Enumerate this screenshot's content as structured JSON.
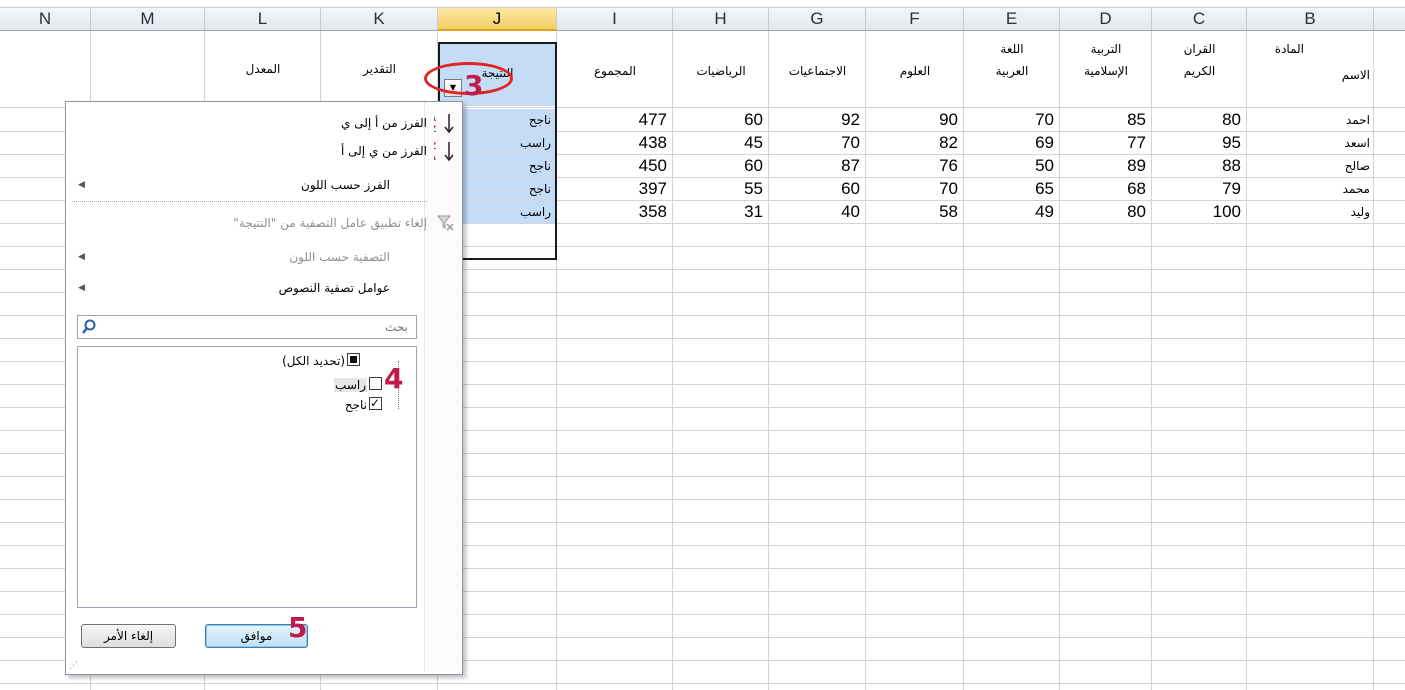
{
  "columns": [
    "N",
    "M",
    "L",
    "K",
    "J",
    "I",
    "H",
    "G",
    "F",
    "E",
    "D",
    "C",
    "B"
  ],
  "selected_column": "J",
  "headers": {
    "L": "المعدل",
    "K": "التقدير",
    "J": "النتيجة",
    "I": "المجموع",
    "H": "الرياضيات",
    "G": "الاجتماعيات",
    "F": "العلوم",
    "E1": "اللغة",
    "E2": "العربية",
    "D1": "التربية",
    "D2": "الإسلامية",
    "C1": "القران",
    "C2": "الكريم",
    "B1": "المادة",
    "B2": "الاسم"
  },
  "rows": [
    {
      "J": "ناجح",
      "I": "477",
      "H": "60",
      "G": "92",
      "F": "90",
      "E": "70",
      "D": "85",
      "C": "80",
      "B": "احمد"
    },
    {
      "J": "راسب",
      "I": "438",
      "H": "45",
      "G": "70",
      "F": "82",
      "E": "69",
      "D": "77",
      "C": "95",
      "B": "اسعد"
    },
    {
      "J": "ناجح",
      "I": "450",
      "H": "60",
      "G": "87",
      "F": "76",
      "E": "50",
      "D": "89",
      "C": "88",
      "B": "صالح"
    },
    {
      "J": "ناجح",
      "I": "397",
      "H": "55",
      "G": "60",
      "F": "70",
      "E": "65",
      "D": "68",
      "C": "79",
      "B": "محمد"
    },
    {
      "J": "راسب",
      "I": "358",
      "H": "31",
      "G": "40",
      "F": "58",
      "E": "49",
      "D": "80",
      "C": "100",
      "B": "وليد"
    }
  ],
  "filter_menu": {
    "sort_asc": "الفرز من أ إلى ي",
    "sort_desc": "الفرز من ي إلى أ",
    "sort_by_color": "الفرز حسب اللون",
    "clear_filter": "إلغاء تطبيق عامل التصفية من \"النتيجة\"",
    "filter_by_color": "التصفية حسب اللون",
    "text_filters": "عوامل تصفية النصوص",
    "search_placeholder": "بحث",
    "select_all": "(تحديد الكل)",
    "items": [
      {
        "label": "راسب",
        "checked": false
      },
      {
        "label": "ناجح",
        "checked": true
      }
    ],
    "ok_label": "موافق",
    "cancel_label": "إلغاء الأمر",
    "sort_asc_glyph": "A/Z",
    "sort_desc_glyph": "Z/A"
  },
  "annotations": {
    "step3": "3",
    "step4": "4",
    "step5": "5"
  },
  "colors": {
    "selection": "#c5dcf7",
    "header_selected": "#f5cf63",
    "annotation": "#c21a4a",
    "ellipse": "#e02424"
  }
}
